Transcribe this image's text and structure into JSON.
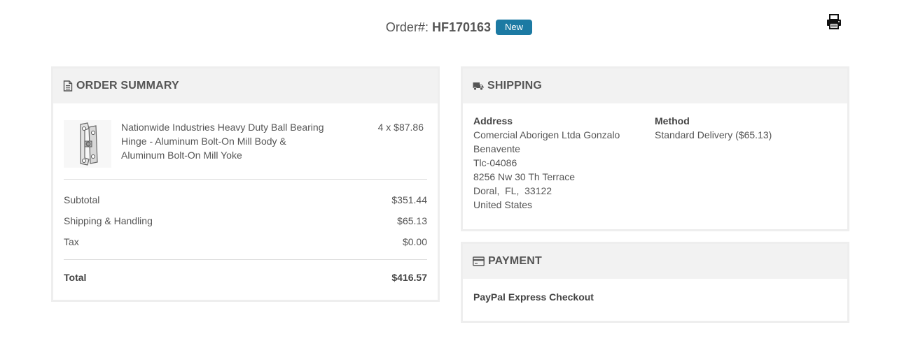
{
  "header": {
    "order_label": "Order#:",
    "order_number": "HF170163",
    "status": "New",
    "print_icon": "printer-icon"
  },
  "colors": {
    "badge": "#1c7aa3",
    "panel_heading_bg": "#f2f2f2",
    "panel_border": "#eeeeee"
  },
  "order_summary": {
    "title": "ORDER SUMMARY",
    "icon": "document-icon",
    "item": {
      "name": "Nationwide Industries Heavy Duty Ball Bearing Hinge - Aluminum Bolt-On Mill Body & Aluminum Bolt-On Mill Yoke",
      "qty_price": "4 x $87.86"
    },
    "subtotal_label": "Subtotal",
    "subtotal_value": "$351.44",
    "shipping_label": "Shipping & Handling",
    "shipping_value": "$65.13",
    "tax_label": "Tax",
    "tax_value": "$0.00",
    "total_label": "Total",
    "total_value": "$416.57"
  },
  "shipping": {
    "title": "SHIPPING",
    "icon": "truck-icon",
    "address_title": "Address",
    "address_lines": [
      "Comercial Aborigen Ltda Gonzalo",
      "Benavente",
      "Tlc-04086",
      "8256 Nw 30 Th Terrace",
      "Doral,  FL,  33122",
      "United States"
    ],
    "method_title": "Method",
    "method_value": "Standard Delivery ($65.13)"
  },
  "payment": {
    "title": "PAYMENT",
    "icon": "credit-card-icon",
    "method": "PayPal Express Checkout"
  }
}
